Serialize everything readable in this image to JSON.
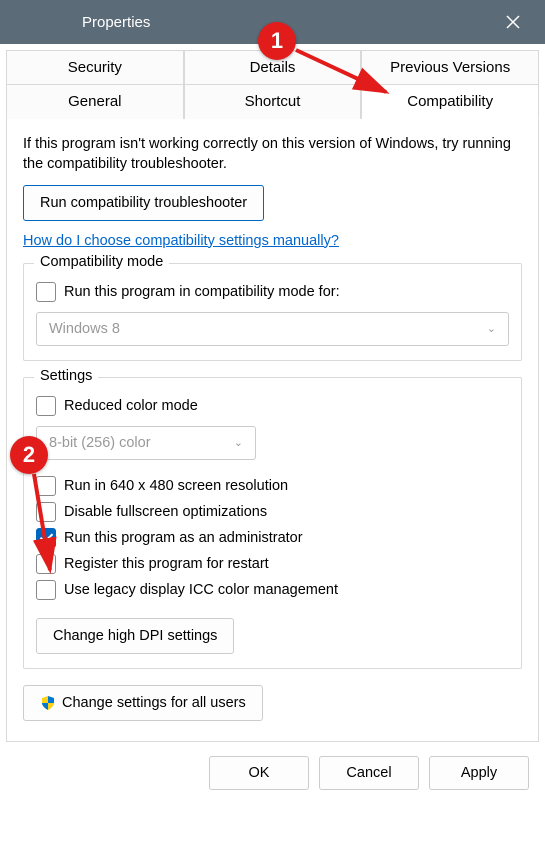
{
  "window": {
    "title": "Properties"
  },
  "tabs": {
    "row1": [
      "Security",
      "Details",
      "Previous Versions"
    ],
    "row2": [
      "General",
      "Shortcut",
      "Compatibility"
    ]
  },
  "intro_text": "If this program isn't working correctly on this version of Windows, try running the compatibility troubleshooter.",
  "troubleshoot_button": "Run compatibility troubleshooter",
  "help_link": "How do I choose compatibility settings manually?",
  "compat_mode": {
    "legend": "Compatibility mode",
    "checkbox_label": "Run this program in compatibility mode for:",
    "select_value": "Windows 8"
  },
  "settings": {
    "legend": "Settings",
    "reduced_color_label": "Reduced color mode",
    "color_select_value": "8-bit (256) color",
    "run_640_label": "Run in 640 x 480 screen resolution",
    "disable_fullscreen_label": "Disable fullscreen optimizations",
    "run_admin_label": "Run this program as an administrator",
    "register_restart_label": "Register this program for restart",
    "use_legacy_icc_label": "Use legacy display ICC color management",
    "high_dpi_button": "Change high DPI settings"
  },
  "all_users_button": "Change settings for all users",
  "buttons": {
    "ok": "OK",
    "cancel": "Cancel",
    "apply": "Apply"
  },
  "annotations": {
    "badge1": "1",
    "badge2": "2"
  }
}
